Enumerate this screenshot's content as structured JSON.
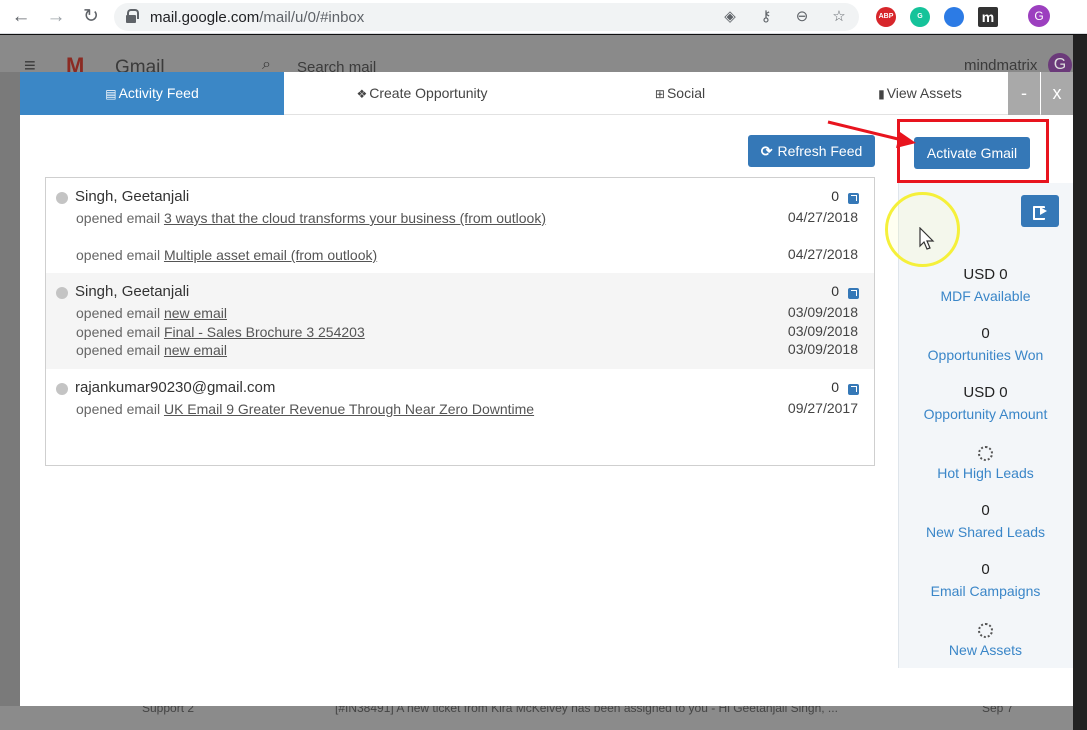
{
  "browser": {
    "url_host": "mail.google.com",
    "url_path": "/mail/u/0/#inbox",
    "profile_initial": "G",
    "extensions": [
      {
        "name": "adblock-icon",
        "label": "ABP",
        "color": "#d7262b"
      },
      {
        "name": "grammarly-icon",
        "label": "G",
        "color": "#15c39a"
      },
      {
        "name": "chat-icon",
        "label": "",
        "color": "#2c7be5"
      },
      {
        "name": "mindmatrix-icon",
        "label": "m",
        "color": "#333333"
      }
    ]
  },
  "gmail_bg": {
    "brand": "Gmail",
    "search_placeholder": "Search mail",
    "account_label": "mindmatrix",
    "account_initial": "G",
    "footer_sender": "Support 2",
    "footer_text": "[#IN38491] A new ticket from Kira McKelvey has been assigned to you - Hi Geetanjali Singh, ...",
    "footer_date": "Sep 7"
  },
  "tabs": [
    {
      "label": "Activity Feed",
      "icon": "rss-icon",
      "glyph": "▤",
      "active": true
    },
    {
      "label": "Create Opportunity",
      "icon": "cubes-icon",
      "glyph": "❖",
      "active": false
    },
    {
      "label": "Social",
      "icon": "sitemap-icon",
      "glyph": "⊞",
      "active": false
    },
    {
      "label": "View Assets",
      "icon": "file-icon",
      "glyph": "▮",
      "active": false
    }
  ],
  "window_controls": {
    "minimize": "-",
    "close": "x"
  },
  "buttons": {
    "refresh": "Refresh Feed",
    "refresh_glyph": "⟳",
    "activate": "Activate Gmail"
  },
  "feed": [
    {
      "name": "Singh, Geetanjali",
      "count": "0",
      "activities": [
        {
          "action": "opened email",
          "subject": "3 ways that the cloud transforms your business (from outlook)",
          "date": "04/27/2018"
        },
        {
          "action": "opened email",
          "subject": "Multiple asset email (from outlook)",
          "date": "04/27/2018"
        }
      ]
    },
    {
      "name": "Singh, Geetanjali",
      "count": "0",
      "activities": [
        {
          "action": "opened email",
          "subject": "new email",
          "date": "03/09/2018"
        },
        {
          "action": "opened email",
          "subject": "Final - Sales Brochure 3 254203",
          "date": "03/09/2018"
        },
        {
          "action": "opened email",
          "subject": "new email",
          "date": "03/09/2018"
        }
      ]
    },
    {
      "name": "rajankumar90230@gmail.com",
      "count": "0",
      "activities": [
        {
          "action": "opened email",
          "subject": "UK Email 9 Greater Revenue Through Near Zero Downtime",
          "date": "09/27/2017"
        }
      ]
    }
  ],
  "stats": [
    {
      "value": "USD 0",
      "label": "MDF Available"
    },
    {
      "value": "0",
      "label": "Opportunities Won"
    },
    {
      "value": "USD 0",
      "label": "Opportunity Amount"
    },
    {
      "value": "",
      "label": "Hot High Leads",
      "loading": true
    },
    {
      "value": "0",
      "label": "New Shared Leads"
    },
    {
      "value": "0",
      "label": "Email Campaigns"
    },
    {
      "value": "",
      "label": "New Assets",
      "loading": true
    }
  ],
  "colors": {
    "accent": "#3578b7",
    "active_tab": "#3b87c6",
    "highlight": "#e8141e",
    "stat_label": "#3a86c8",
    "cursor_ring": "#f5f03a"
  }
}
